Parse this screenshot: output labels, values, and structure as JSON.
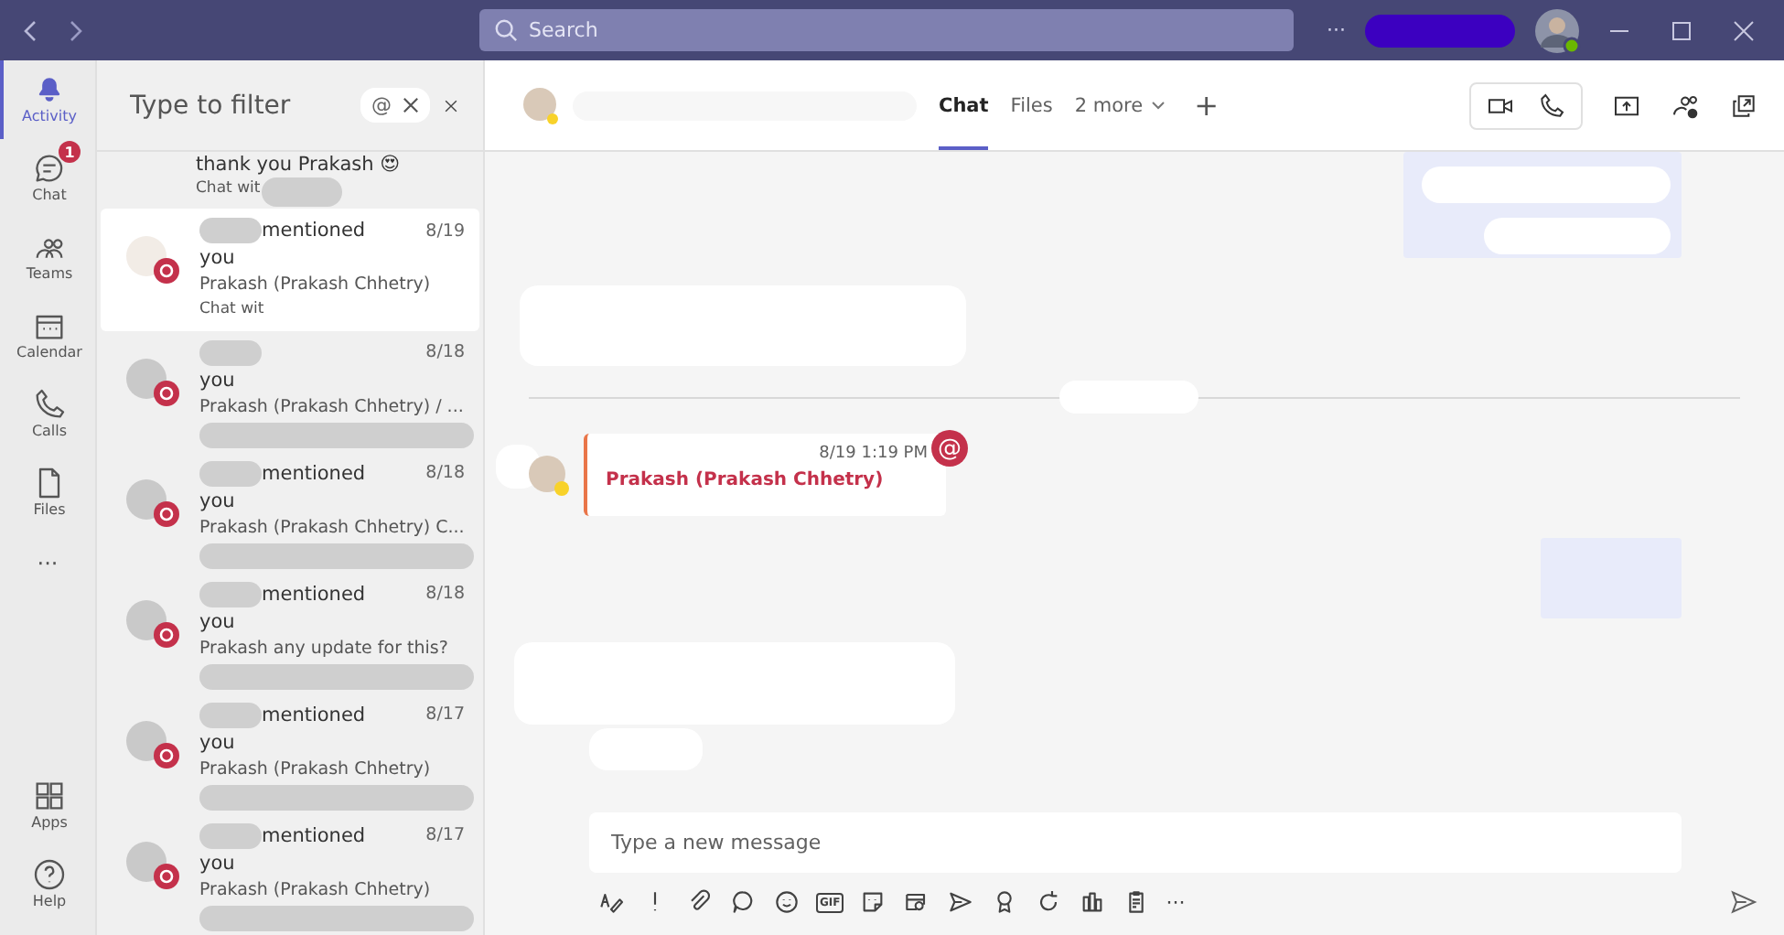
{
  "title_bar": {
    "search_placeholder": "Search",
    "more": "···"
  },
  "rail": {
    "items": [
      {
        "label": "Activity",
        "selected": true
      },
      {
        "label": "Chat",
        "selected": false,
        "badge": "1"
      },
      {
        "label": "Teams",
        "selected": false
      },
      {
        "label": "Calendar",
        "selected": false
      },
      {
        "label": "Calls",
        "selected": false
      },
      {
        "label": "Files",
        "selected": false
      }
    ],
    "more": "···",
    "bottom": [
      {
        "label": "Apps",
        "selected": false
      },
      {
        "label": "Help",
        "selected": false
      }
    ]
  },
  "feed": {
    "filter_placeholder": "Type to filter",
    "filter_chip": "@",
    "items": [
      {
        "kind": "partial",
        "preview": "thank you Prakash 😍",
        "context": "Chat wit",
        "selected": false
      },
      {
        "kind": "full",
        "action": "mentioned",
        "date": "8/19",
        "target": "you",
        "preview": "Prakash (Prakash Chhetry)",
        "context": "Chat wit",
        "selected": true
      },
      {
        "kind": "full",
        "date": "8/18",
        "target": "you",
        "preview": "Prakash (Prakash Chhetry) / ...",
        "selected": false
      },
      {
        "kind": "full",
        "action": "mentioned",
        "date": "8/18",
        "target": "you",
        "preview": "Prakash (Prakash Chhetry) C...",
        "selected": false
      },
      {
        "kind": "full",
        "action": "mentioned",
        "date": "8/18",
        "target": "you",
        "preview": "Prakash any update for this?",
        "selected": false
      },
      {
        "kind": "full",
        "action": "mentioned",
        "date": "8/17",
        "target": "you",
        "preview": "Prakash (Prakash Chhetry)",
        "selected": false
      },
      {
        "kind": "full",
        "action": "mentioned",
        "date": "8/17",
        "target": "you",
        "preview": "Prakash (Prakash Chhetry)",
        "selected": false
      }
    ]
  },
  "chat": {
    "tabs": [
      {
        "label": "Chat",
        "selected": true
      },
      {
        "label": "Files",
        "selected": false
      },
      {
        "label": "2 more",
        "selected": false,
        "dropdown": true
      }
    ],
    "add_tab": "+",
    "message": {
      "time": "8/19 1:19 PM",
      "mention": "Prakash (Prakash Chhetry)",
      "mark": "@"
    },
    "compose_placeholder": "Type a new message",
    "toolbar_gif": "GIF"
  }
}
